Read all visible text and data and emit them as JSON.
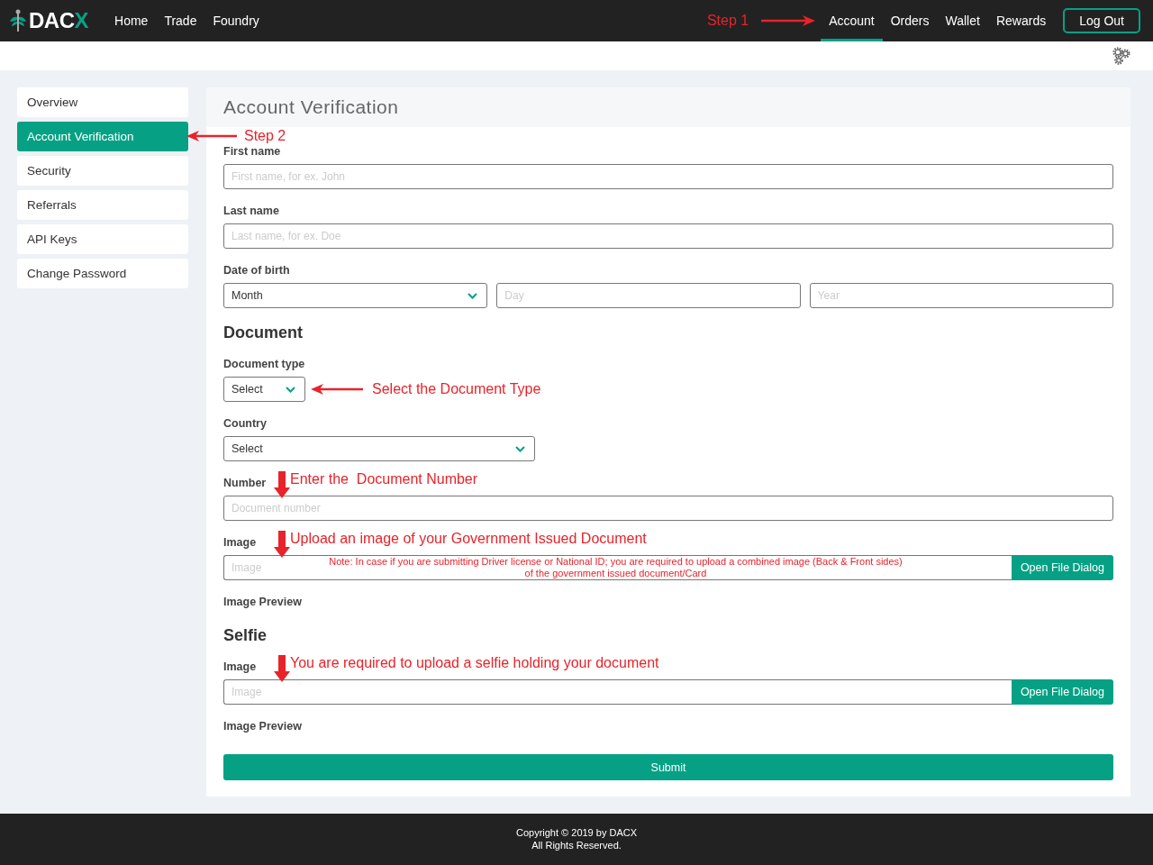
{
  "navbar": {
    "logo": {
      "text": "DAC",
      "accent": "X"
    },
    "left_links": [
      {
        "label": "Home",
        "selected": false
      },
      {
        "label": "Trade",
        "selected": false
      },
      {
        "label": "Foundry",
        "selected": false
      }
    ],
    "annotation": "Step 1",
    "right_links": [
      {
        "label": "Account",
        "selected": true
      },
      {
        "label": "Orders",
        "selected": false
      },
      {
        "label": "Wallet",
        "selected": false
      },
      {
        "label": "Rewards",
        "selected": false
      }
    ],
    "logout": "Log Out"
  },
  "sidebar": {
    "items": [
      {
        "label": "Overview",
        "selected": false
      },
      {
        "label": "Account Verification",
        "selected": true,
        "annotation": "Step 2"
      },
      {
        "label": "Security",
        "selected": false
      },
      {
        "label": "Referrals",
        "selected": false
      },
      {
        "label": "API Keys",
        "selected": false
      },
      {
        "label": "Change Password",
        "selected": false
      }
    ]
  },
  "panel": {
    "title": "Account Verification",
    "items": [
      {
        "kind": "text",
        "label": "First name",
        "placeholder": "First name, for ex. John"
      },
      {
        "kind": "text",
        "label": "Last name",
        "placeholder": "Last name, for ex. Doe"
      },
      {
        "kind": "date",
        "label": "Date of birth",
        "month": "Month",
        "day_placeholder": "Day",
        "year_placeholder": "Year"
      },
      {
        "kind": "heading",
        "label": "Document"
      },
      {
        "kind": "dropdown",
        "label": "Document type",
        "value": "Select",
        "annotation": "Select the Document Type"
      },
      {
        "kind": "select",
        "label": "Country",
        "value": "Select"
      },
      {
        "kind": "text",
        "label": "Number",
        "placeholder": "Document number",
        "annotation": "Enter the  Document Number"
      },
      {
        "kind": "file",
        "label": "Image",
        "placeholder": "Image",
        "button": "Open File Dialog",
        "annotation": "Upload an image of your Government Issued Document",
        "note": [
          "Note: In case if you are submitting Driver license or National ID; you are required to upload a combined image (Back & Front sides)",
          "of the government issued document/Card"
        ]
      },
      {
        "kind": "caption",
        "label": "Image Preview"
      },
      {
        "kind": "heading",
        "label": "Selfie"
      },
      {
        "kind": "file",
        "label": "Image",
        "placeholder": "Image",
        "button": "Open File Dialog",
        "annotation": "You are required to upload a selfie holding your document"
      },
      {
        "kind": "caption",
        "label": "Image Preview"
      }
    ],
    "submit": "Submit"
  },
  "footer": {
    "lines": [
      "Copyright © 2019 by DACX",
      "All Rights Reserved."
    ]
  }
}
